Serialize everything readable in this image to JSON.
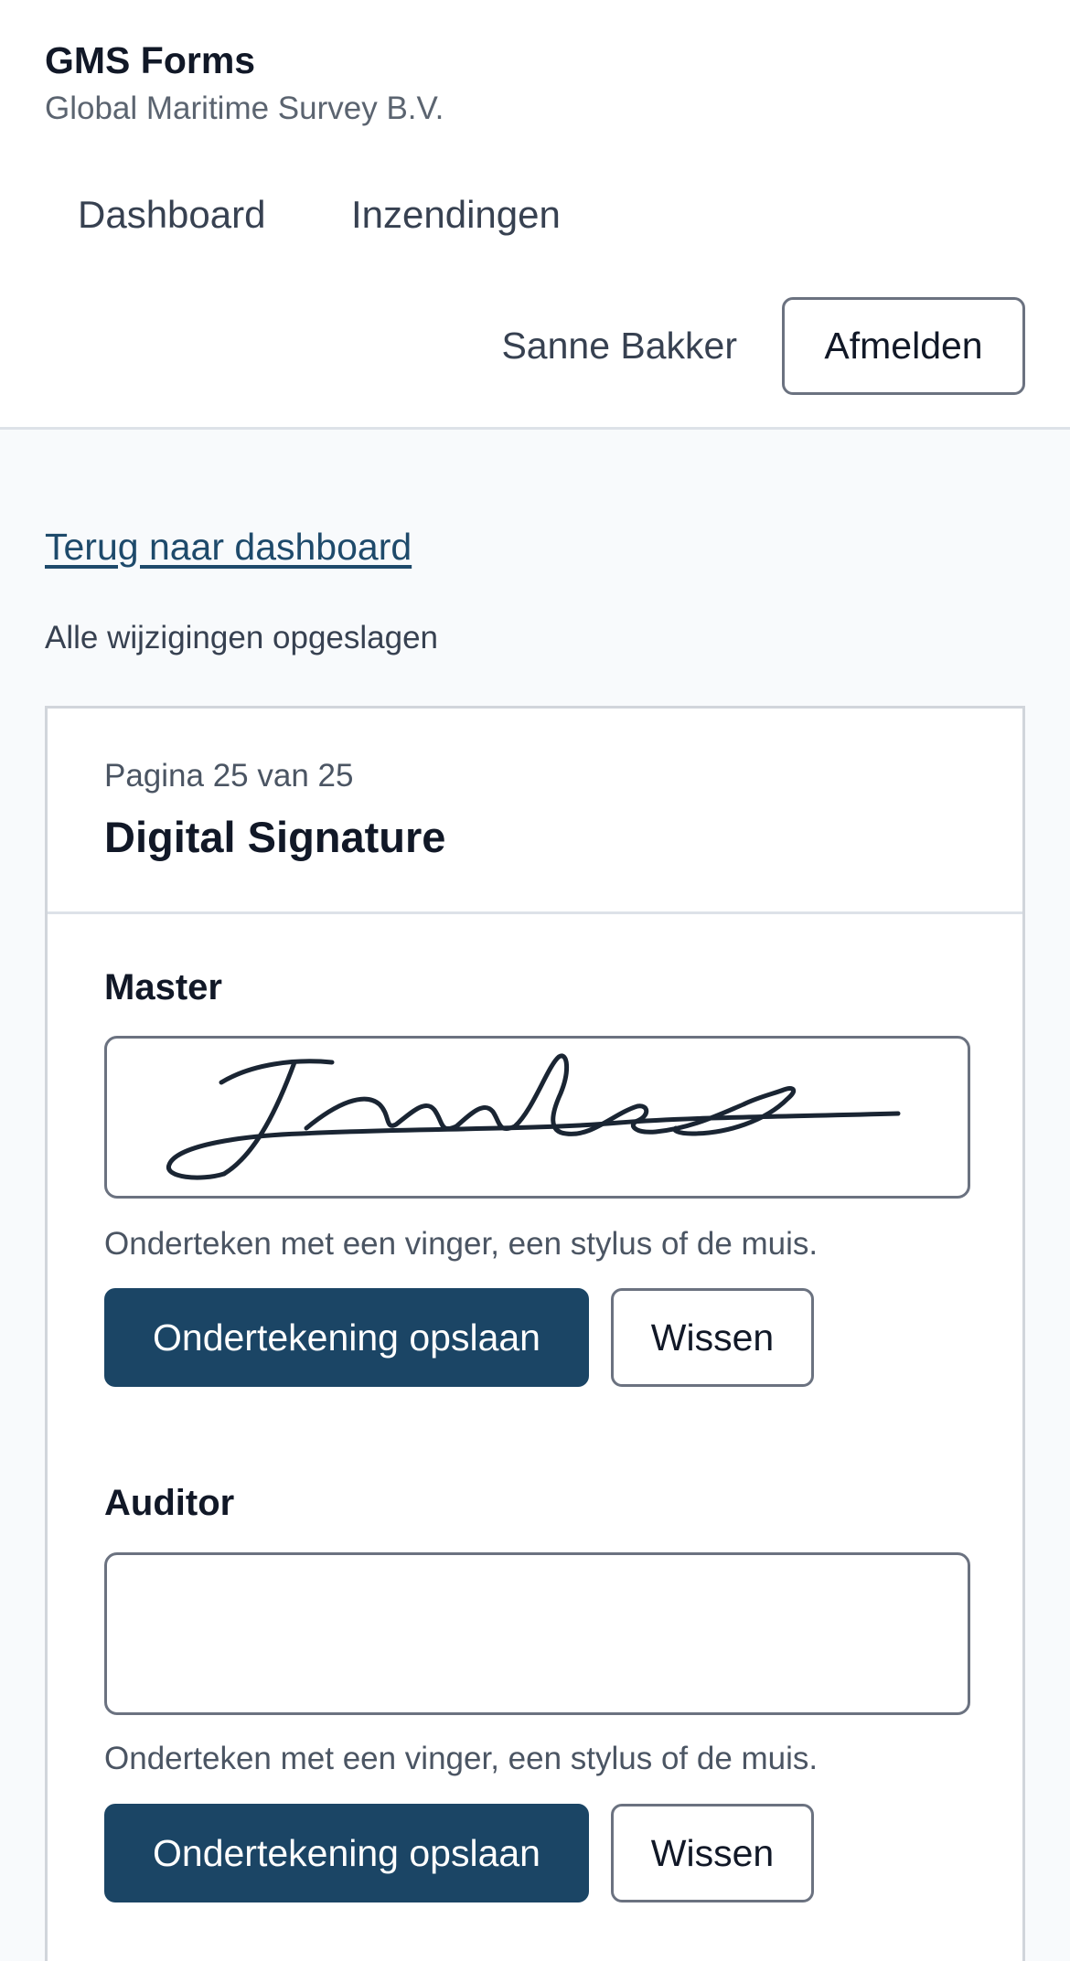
{
  "header": {
    "app_title": "GMS Forms",
    "organization": "Global Maritime Survey B.V.",
    "nav": {
      "dashboard": "Dashboard",
      "submissions": "Inzendingen"
    },
    "user_name": "Sanne Bakker",
    "logout_label": "Afmelden"
  },
  "main": {
    "back_link": "Terug naar dashboard",
    "save_status": "Alle wijzigingen opgeslagen",
    "form": {
      "page_counter": "Pagina 25 van 25",
      "page_title": "Digital Signature",
      "signatures": [
        {
          "label": "Master",
          "signed": true,
          "hint": "Onderteken met een vinger, een stylus of de muis.",
          "save_label": "Ondertekening opslaan",
          "clear_label": "Wissen"
        },
        {
          "label": "Auditor",
          "signed": false,
          "hint": "Onderteken met een vinger, een stylus of de muis.",
          "save_label": "Ondertekening opslaan",
          "clear_label": "Wissen"
        }
      ]
    }
  },
  "colors": {
    "primary": "#1b4565",
    "link": "#1e4a6b",
    "page_background": "#f8fafc",
    "ink": "#1a2533"
  }
}
